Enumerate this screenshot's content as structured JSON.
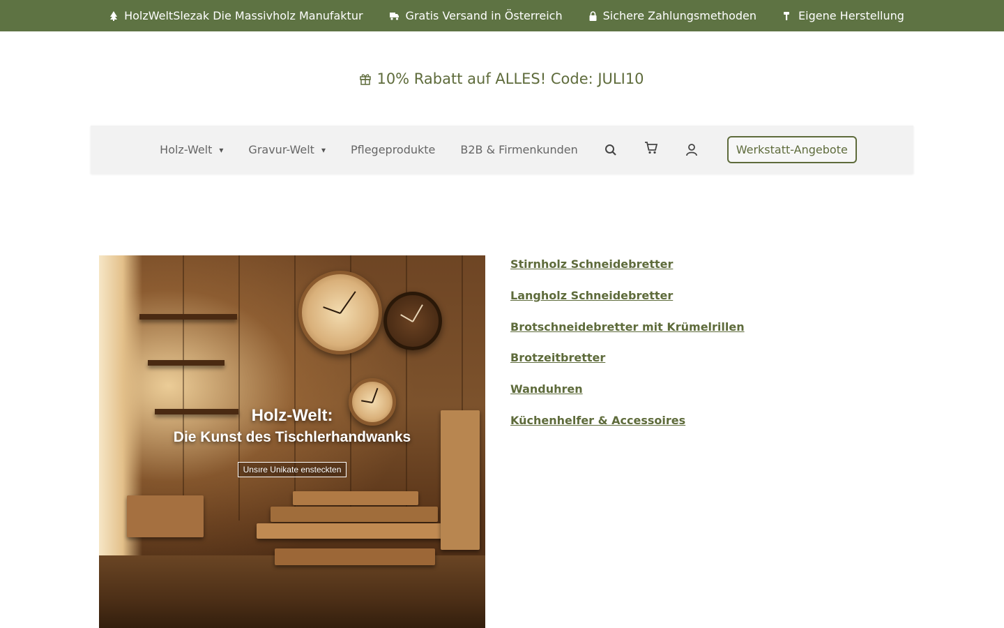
{
  "topbar": {
    "items": [
      {
        "label": "HolzWeltSlezak Die Massivholz Manufaktur",
        "icon": "tree-icon"
      },
      {
        "label": "Gratis Versand in Österreich",
        "icon": "truck-icon"
      },
      {
        "label": "Sichere Zahlungsmethoden",
        "icon": "lock-icon"
      },
      {
        "label": "Eigene Herstellung",
        "icon": "hammer-icon"
      }
    ]
  },
  "promo": {
    "icon": "gift-icon",
    "text": "10% Rabatt auf ALLES! Code: JULI10"
  },
  "nav": {
    "items": [
      {
        "label": "Holz-Welt",
        "has_dropdown": true
      },
      {
        "label": "Gravur-Welt",
        "has_dropdown": true
      },
      {
        "label": "Pflegeprodukte",
        "has_dropdown": false
      },
      {
        "label": "B2B & Firmenkunden",
        "has_dropdown": false
      }
    ],
    "caret": "▾",
    "icons": [
      "search-icon",
      "cart-icon",
      "user-icon"
    ],
    "cta_label": "Werkstatt-Angebote"
  },
  "hero": {
    "title": "Holz-Welt:",
    "subtitle": "Die Kunst des Tischlerhandwanks",
    "button_label": "Unsıre Unikate ensteckten"
  },
  "categories": [
    "Stirnholz Schneidebretter",
    "Langholz Schneidebretter",
    "Brotschneidebretter mit Krümelrillen",
    "Brotzeitbretter",
    "Wanduhren",
    "Küchenhelfer & Accessoires"
  ],
  "colors": {
    "topbar_bg": "#5e7343",
    "accent": "#5e6b3b",
    "nav_bg": "#f2f2f2"
  }
}
